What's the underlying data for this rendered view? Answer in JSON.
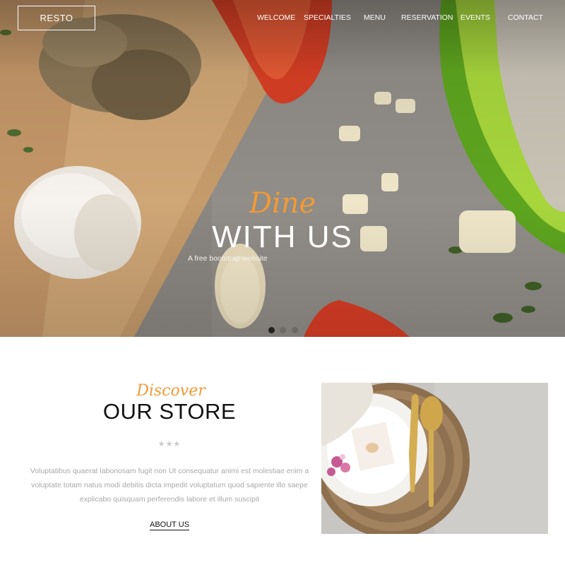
{
  "brand": {
    "logo": "RESTO"
  },
  "nav": {
    "items": [
      "WELCOME",
      "SPECIALTIES",
      "MENU",
      "RESERVATION",
      "EVENTS",
      "CONTACT"
    ]
  },
  "hero": {
    "script": "Dine",
    "title": "WITH US",
    "subtitle": "A free bootstrap website",
    "slides_total": 3,
    "active_slide": 1,
    "image": "ingredients on cutting board: garlic, tomato, lime, pepper"
  },
  "about": {
    "script": "Discover",
    "title": "OUR STORE",
    "stars": "★★★",
    "text": "Voluptatibus quaerat laboriosam fugit non Ut consequatur animi est molestiae enim a voluptate totam natus modi debitis dicta impedit voluptatum quod sapiente illo saepe explicabo quisquam perferendis labore et illum suscipit",
    "link": "ABOUT US",
    "image": "table setting with gold cutlery on woven placemat"
  },
  "colors": {
    "accent": "#f19a36",
    "text_dark": "#111111",
    "text_muted": "#a9a9a9"
  }
}
